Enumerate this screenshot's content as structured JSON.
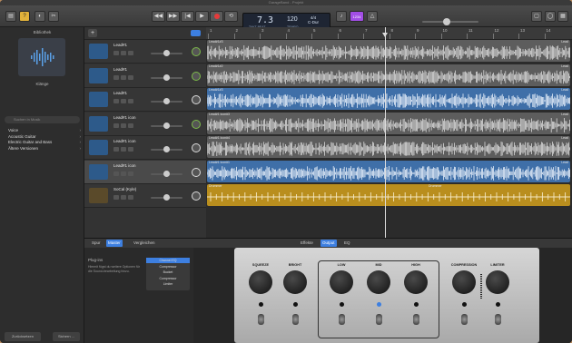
{
  "window": {
    "title": "GarageBand - Projekt"
  },
  "toolbar": {
    "transport": {
      "rewind": "◀◀",
      "forward": "▶▶",
      "to_start": "|◀",
      "play": "▶",
      "cycle": "⟲"
    },
    "lcd": {
      "position": "7.3",
      "pos_sub": "TAKT   BEAT",
      "tempo": "120",
      "tempo_sub": "TEMPO",
      "signature": "4/4",
      "key": "C-Dur"
    },
    "count_in": "1234"
  },
  "library": {
    "title": "Bibliothek",
    "subtitle": "Klänge",
    "search_placeholder": "Suchen in Musik",
    "items": [
      {
        "label": "Voice"
      },
      {
        "label": "Acoustic Guitar"
      },
      {
        "label": "Electric Guitar and Bass"
      },
      {
        "label": "Ältere Versionen"
      }
    ],
    "footer": {
      "restore": "Zurücksetzen",
      "delete": "Sichern ..."
    }
  },
  "tracks": [
    {
      "name": "Lead#1",
      "pan_color": "#7dbb4a",
      "selected": false
    },
    {
      "name": "Lead#1",
      "pan_color": "#7dbb4a",
      "selected": false
    },
    {
      "name": "Lead#1",
      "pan_color": "#dcdcdc",
      "selected": false
    },
    {
      "name": "Lead#1 icon",
      "pan_color": "#7dbb4a",
      "selected": false
    },
    {
      "name": "Lead#1 icon",
      "pan_color": "#dcdcdc",
      "selected": false
    },
    {
      "name": "Lead#1 icon",
      "pan_color": "#dcdcdc",
      "selected": true
    },
    {
      "name": "SoCal (Kyle)",
      "pan_color": "#dcdcdc",
      "selected": false
    }
  ],
  "ruler": {
    "bars": [
      "1",
      "2",
      "3",
      "4",
      "5",
      "6",
      "7",
      "8",
      "9",
      "10",
      "11",
      "12",
      "13",
      "14"
    ]
  },
  "regions": [
    {
      "label": "Lead#1#3",
      "right": "Lead",
      "color": "grey"
    },
    {
      "label": "Lead#1#2",
      "right": "Lead",
      "color": "grey"
    },
    {
      "label": "Lead#1#3",
      "right": "Lead",
      "color": "blue"
    },
    {
      "label": "Lead#1 icon#3",
      "right": "Lead",
      "color": "grey"
    },
    {
      "label": "Lead#1 icon#4",
      "right": "Lead",
      "color": "grey"
    },
    {
      "label": "Lead#1 icon#1",
      "right": "Lead",
      "color": "blue"
    },
    {
      "label": "Drummer",
      "right": "Drummer",
      "color": "gold"
    }
  ],
  "editor": {
    "tabs_left": {
      "track": "Spur",
      "master": "Master",
      "compare": "Vergleichen"
    },
    "tabs_right": {
      "effects": "Effekte",
      "output": "Output",
      "eq": "EQ"
    },
    "plugins_title": "Plug-ins",
    "plugins_desc": "Hiermit fügst du weitere Optionen für die Sound-bearbeitung hinzu.",
    "plugins": [
      {
        "label": "Channel EQ",
        "on": true
      },
      {
        "label": "Compressor",
        "on": false
      },
      {
        "label": "Bucket",
        "on": false
      },
      {
        "label": "Compressor",
        "on": false
      },
      {
        "label": "Limiter",
        "on": false
      }
    ]
  },
  "amp": {
    "knobs": [
      "SQUEEZE",
      "BRIGHT",
      "LOW",
      "MID",
      "HIGH",
      "COMPRESSION",
      "LIMITER"
    ]
  }
}
